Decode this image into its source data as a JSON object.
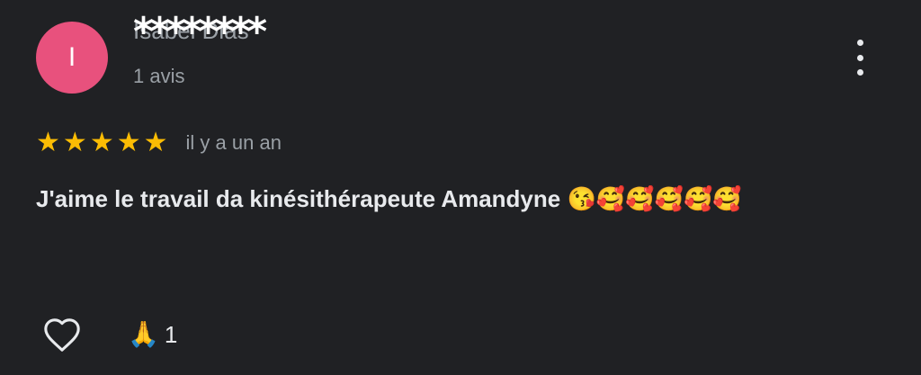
{
  "author": {
    "initial": "I",
    "name": "Isabel Dias",
    "name_mask": "********",
    "review_count": "1 avis",
    "avatar_color": "#e8517d"
  },
  "review": {
    "rating": 5,
    "stars": [
      "★",
      "★",
      "★",
      "★",
      "★"
    ],
    "date": "il y a un an",
    "text": "J'aime le travail da kinésithérapeute Amandyne 😘🥰🥰🥰🥰🥰"
  },
  "actions": {
    "like_icon": "heart-outline-icon",
    "reaction_emoji": "🙏",
    "reaction_count": "1",
    "more_icon": "more-vert-icon"
  },
  "colors": {
    "background": "#202124",
    "star": "#fbbc04",
    "secondary_text": "#9aa0a6",
    "primary_text": "#e8eaed"
  }
}
